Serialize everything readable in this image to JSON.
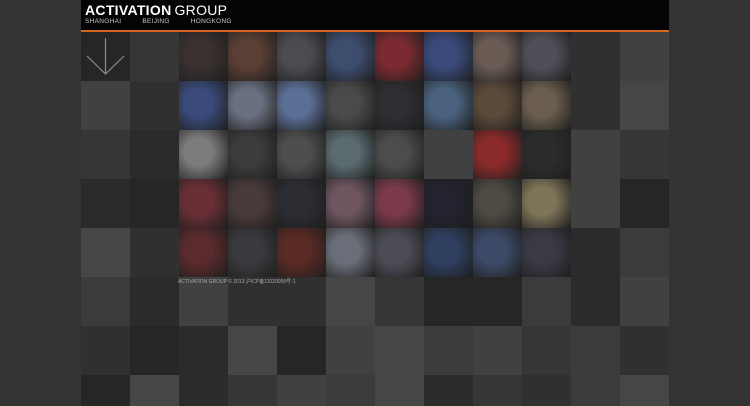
{
  "header": {
    "logo_main": "ACTIVATION",
    "logo_sub": "GROUP",
    "cities": [
      "SHANGHAI",
      "BEIJING",
      "HONGKONG"
    ]
  },
  "footer": {
    "text": "ACTIVATION GROUP © 2013 沪ICP备11020058号-1"
  },
  "colors": {
    "background": "#333333",
    "header": "#040404",
    "accent": "#d8661f",
    "logo": "#ffffff"
  },
  "icons": {
    "scroll": "arrow-down-icon"
  }
}
